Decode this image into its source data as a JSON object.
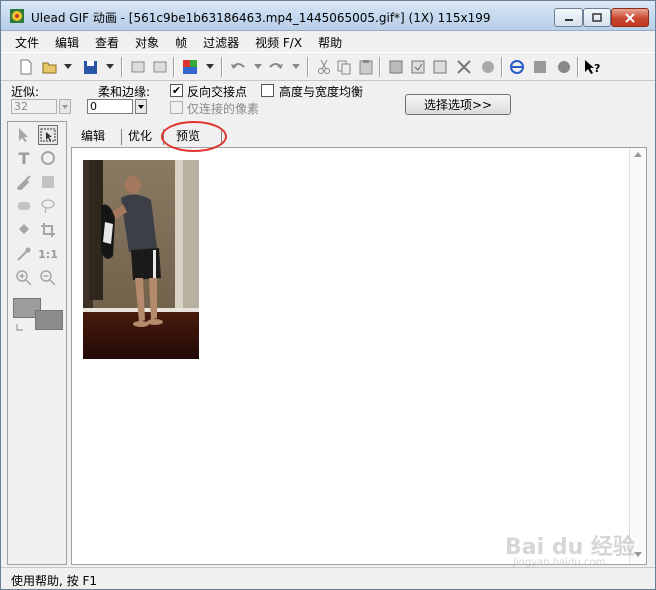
{
  "window": {
    "title": "Ulead GIF 动画 - [561c9be1b63186463.mp4_1445065005.gif*] (1X) 115x199"
  },
  "menu": [
    "文件",
    "编辑",
    "查看",
    "对象",
    "帧",
    "过滤器",
    "视频 F/X",
    "帮助"
  ],
  "toolbar_icons": [
    "new-icon",
    "open-icon",
    "save-icon",
    "import-icon",
    "export-icon",
    "color-icon",
    "undo-icon",
    "redo-icon",
    "cut-icon",
    "copy-icon",
    "paste-icon",
    "frame-icon",
    "optimize-icon",
    "resize-icon",
    "crop-icon",
    "browser-icon",
    "preview-icon",
    "web-icon",
    "help-icon"
  ],
  "options": {
    "similar_label": "近似:",
    "similar_value": "32",
    "feather_label": "柔和边缘:",
    "feather_value": "0",
    "invert_label": "反向交接点",
    "invert_checked": "✔",
    "aspect_label": "高度与宽度均衡",
    "contiguous_label": "仅连接的像素",
    "select_button": "选择选项>>"
  },
  "tabs": {
    "edit": "编辑",
    "optimize": "优化",
    "preview": "预览"
  },
  "status": {
    "text": "使用帮助, 按 F1"
  },
  "watermark": {
    "main": "Bai du 经验",
    "sub": "jingyan.baidu.com"
  },
  "colors": {
    "accent_circle": "#e0342c",
    "selection_fg": "#9c9c9c",
    "selection_bg": "#8c8c8c"
  }
}
